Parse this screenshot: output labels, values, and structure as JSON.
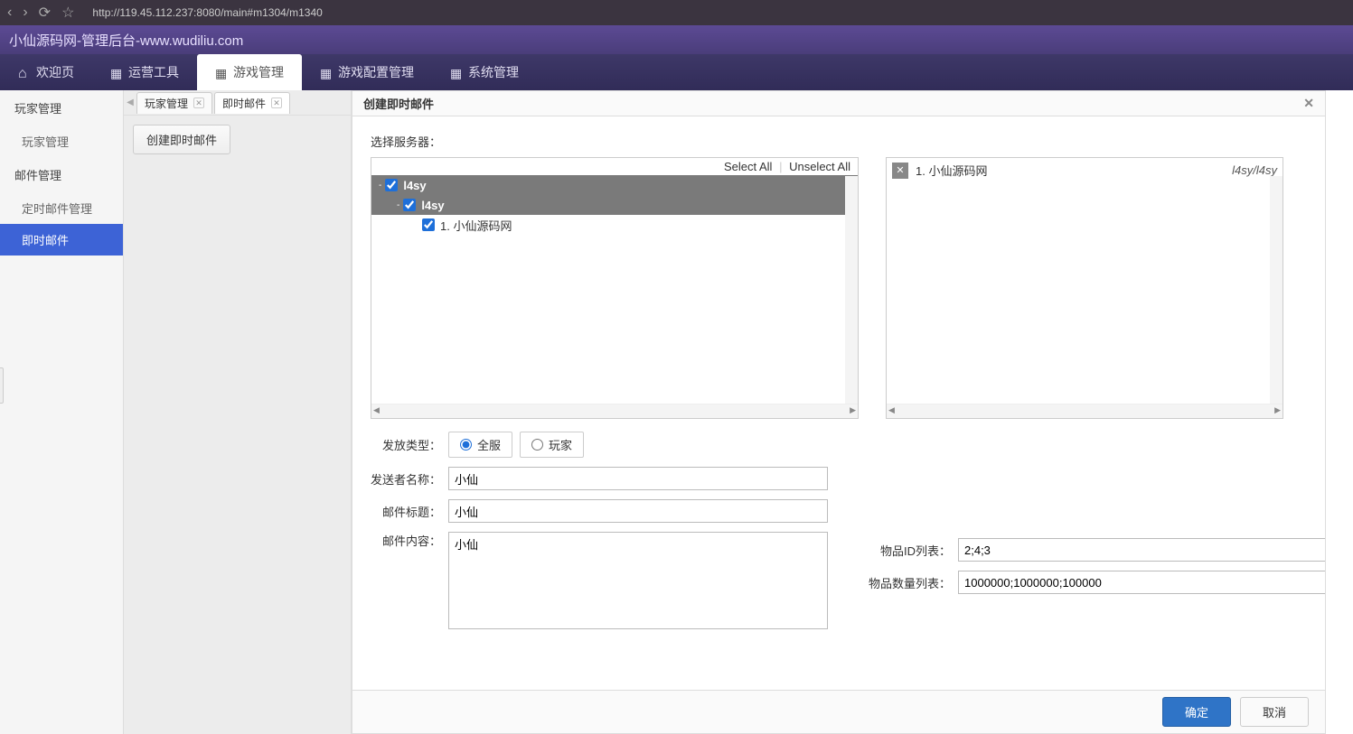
{
  "browser": {
    "url": "http://119.45.112.237:8080/main#m1304/m1340"
  },
  "title": "小仙源码网-管理后台-www.wudiliu.com",
  "nav": [
    {
      "label": "欢迎页",
      "icon": "home"
    },
    {
      "label": "运营工具",
      "icon": "grid"
    },
    {
      "label": "游戏管理",
      "icon": "grid",
      "active": true
    },
    {
      "label": "游戏配置管理",
      "icon": "grid"
    },
    {
      "label": "系统管理",
      "icon": "grid"
    }
  ],
  "sidebar": {
    "groups": [
      {
        "label": "玩家管理",
        "items": [
          {
            "label": "玩家管理"
          }
        ]
      },
      {
        "label": "邮件管理",
        "items": [
          {
            "label": "定时邮件管理"
          },
          {
            "label": "即时邮件",
            "active": true
          }
        ]
      }
    ]
  },
  "tabs": [
    {
      "label": "玩家管理"
    },
    {
      "label": "即时邮件",
      "active": true
    }
  ],
  "mid_button": "创建即时邮件",
  "panel": {
    "title": "创建即时邮件",
    "server_label": "选择服务器：",
    "select_all": "Select All",
    "unselect_all": "Unselect All",
    "tree": {
      "root": {
        "label": "l4sy",
        "checked": true
      },
      "child": {
        "label": "l4sy",
        "checked": true
      },
      "leaf": {
        "label": "1. 小仙源码网",
        "checked": true
      }
    },
    "selected": {
      "label": "1. 小仙源码网",
      "path": "l4sy/l4sy"
    },
    "form": {
      "dispatch_type_label": "发放类型：",
      "radio_all": "全服",
      "radio_player": "玩家",
      "sender_label": "发送者名称：",
      "sender_value": "小仙",
      "subject_label": "邮件标题：",
      "subject_value": "小仙",
      "content_label": "邮件内容：",
      "content_value": "小仙",
      "item_id_label": "物品ID列表：",
      "item_id_value": "2;4;3",
      "item_qty_label": "物品数量列表：",
      "item_qty_value": "1000000;1000000;100000"
    },
    "buttons": {
      "ok": "确定",
      "cancel": "取消"
    }
  }
}
